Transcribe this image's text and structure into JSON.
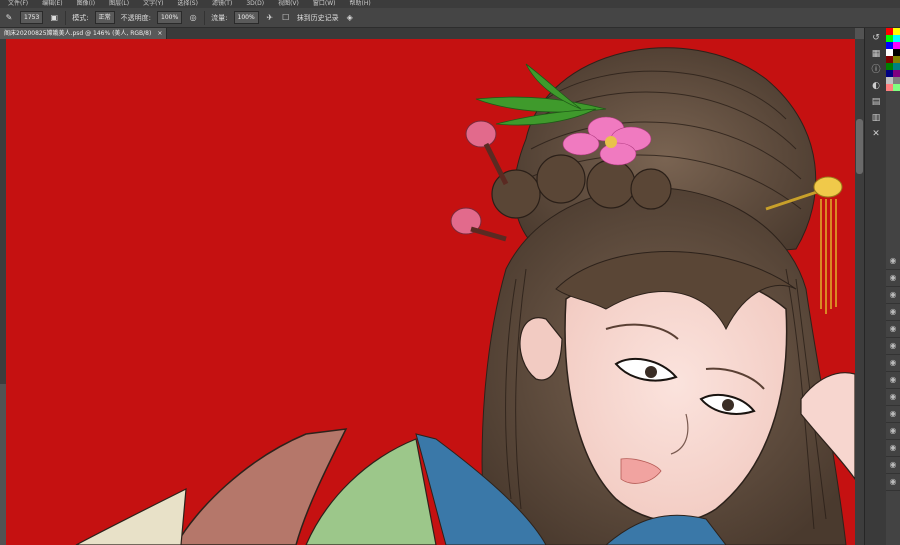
{
  "menu": [
    "文件(F)",
    "编辑(E)",
    "图像(I)",
    "图层(L)",
    "文字(Y)",
    "选择(S)",
    "滤镜(T)",
    "3D(D)",
    "视图(V)",
    "窗口(W)",
    "帮助(H)"
  ],
  "options": {
    "brush_size": "1753",
    "mode_label": "模式:",
    "mode_value": "正常",
    "opacity_label": "不透明度:",
    "opacity_value": "100%",
    "flow_label": "流量:",
    "flow_value": "100%",
    "history_label": "抹到历史记录"
  },
  "document": {
    "tab_title": "阁床20200825嫦娥美人.psd @ 146% (美人, RGB/8)",
    "close_glyph": "×"
  },
  "swatch_colors": [
    "#ff0000",
    "#ffff00",
    "#00ff00",
    "#00ffff",
    "#0000ff",
    "#ff00ff",
    "#ffffff",
    "#000000",
    "#800000",
    "#808000",
    "#008000",
    "#008080",
    "#000080",
    "#800080",
    "#c0c0c0",
    "#808080",
    "#ff8080",
    "#80ff80"
  ],
  "dock_icons": [
    "history-icon",
    "swatches-icon",
    "info-icon",
    "adjustments-icon",
    "layers-icon",
    "channels-icon",
    "paths-icon"
  ],
  "layer_eye_glyph": "◉",
  "layer_rows": 14
}
